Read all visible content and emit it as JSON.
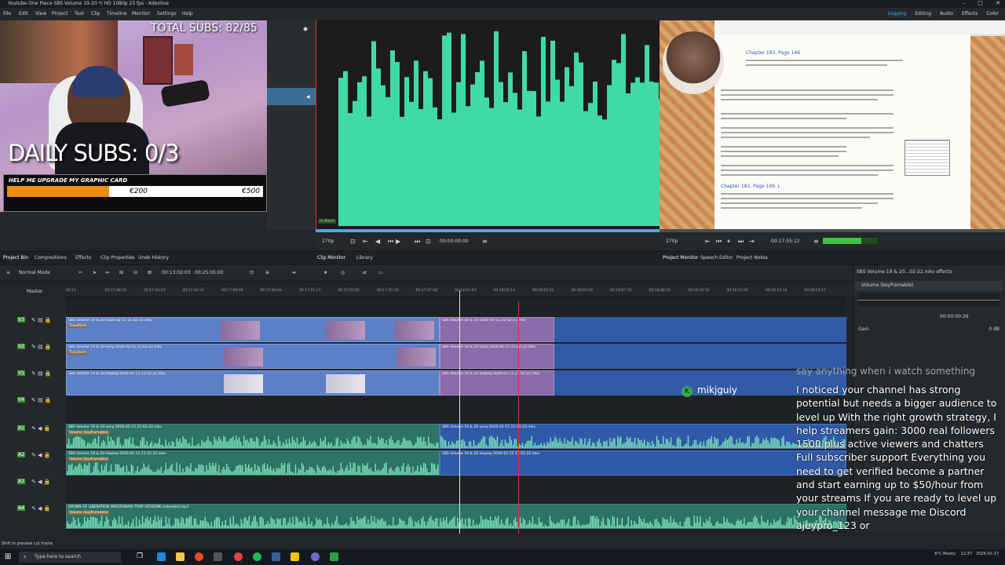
{
  "window": {
    "title": "Youtube-One Piece-SBS Volume 19-20 */ HD 1080p 25 fps - Kdenlive",
    "controls": [
      "–",
      "□",
      "✕"
    ]
  },
  "menu": [
    "File",
    "Edit",
    "View",
    "Project",
    "Tool",
    "Clip",
    "Timeline",
    "Monitor",
    "Settings",
    "Help"
  ],
  "layouts": {
    "items": [
      "Logging",
      "Editing",
      "Audio",
      "Effects",
      "Color"
    ],
    "active": "Logging"
  },
  "overlay": {
    "total_subs": "TOTAL SUBS: 82/85",
    "daily_subs": "DAILY SUBS: 0/3",
    "goal_title": "HELP ME UPGRADE MY GRAPHIC CARD",
    "goal_current": "€200",
    "goal_max": "€500",
    "goal_progress": 0.4
  },
  "clip_monitor": {
    "label": "In Point",
    "zoom": "270p",
    "timecode": "00:00:00:00"
  },
  "project_monitor": {
    "zoom": "270p",
    "timecode": "00:17:55:12",
    "doc_heading1": "Chapter 183, Page 146",
    "doc_heading2": "Chapter 183, Page 146 ↓"
  },
  "dock_tabs_left": [
    "Project Bin",
    "Compositions",
    "Effects",
    "Clip Properties",
    "Undo History"
  ],
  "dock_tabs_mid": [
    "Clip Monitor",
    "Library"
  ],
  "dock_tabs_right": [
    "Project Monitor",
    "Speech Editor",
    "Project Notes"
  ],
  "timeline": {
    "mode": "Normal Mode",
    "position": "00:13:02:03",
    "duration": "00:25:05:00",
    "master": "Master"
  },
  "ruler": [
    "00:11",
    "00:17:48:20",
    "00:17:04:03",
    "00:17:44:22",
    "00:17:09:06",
    "00:17:44:04",
    "00:17:01:17",
    "00:17:03:01",
    "00:17:55:19",
    "00:17:07:08",
    "00:18:01:03",
    "00:18:02:14",
    "00:18:03:22",
    "00:18:05:08",
    "00:18:07:10",
    "00:18:08:20",
    "00:18:10:12",
    "00:18:12:05",
    "00:18:13:14",
    "00:18:14:15"
  ],
  "tracks": {
    "v3_clip": "SBS Volume 19 & 20-2026-02-15 21-02-21.mkv",
    "v2_clip": "SBS Volume 19 & 20-sony-2026-02-15 21-02-22.mkv",
    "v1_clip": "SBS Volume 19 & 20-display-2026-02-15 21-02-22.mkv",
    "a1_clip": "SBS Volume 19 & 20-sony-2026-02-15 21-02-22.mkv",
    "a2_clip": "SBS Volume 19 & 20-display-2026-02-15 21-02-22.mkv",
    "a4_clip": "DRUMS OF LIBERATION (MACRONARI TRAP VERSION) extended.mp3",
    "transform": "Transform",
    "volume": "Volume (keyframable)",
    "headers": [
      "V4",
      "V3",
      "V2",
      "V1",
      "A1",
      "A2",
      "A3",
      "A4"
    ]
  },
  "effects_panel": {
    "title": "SBS Volume 19 & 20...02-22.mkv effects",
    "item": "Volume (keyframable)",
    "timecode": "00:00:00:26",
    "gain": "Gain",
    "gain_value": "0 dB"
  },
  "chat": {
    "faded": "say anything when i watch something",
    "username": "mikjguiy",
    "message": "I noticed your channel has strong potential but needs a bigger audience to level up With the right growth strategy, I help streamers gain: 3000 real followers 1500 plus active viewers and chatters Full subscriber support Everything you need to get verified become a partner and start earning up to $50/hour from your streams If you are ready to level up your channel message me Discord ajeypro_123 or"
  },
  "status": "Shift to preview cut frame",
  "taskbar": {
    "search_placeholder": "Type here to search",
    "weather": "8°C Mostly",
    "time": "12:37",
    "date": "2026-02-17"
  },
  "colors": {
    "accent": "#3daee9",
    "video_track": "#315ba6",
    "audio_clip": "#2c7266",
    "waveform": "#3fdba6"
  }
}
